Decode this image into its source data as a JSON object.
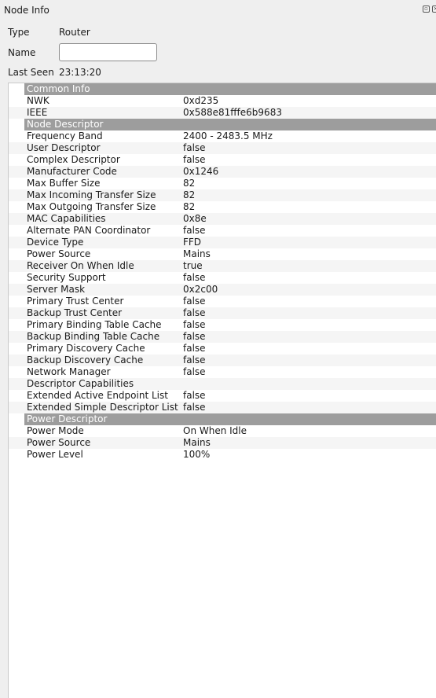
{
  "window": {
    "title": "Node Info"
  },
  "form": {
    "type_label": "Type",
    "type_value": "Router",
    "name_label": "Name",
    "name_value": "",
    "last_seen_label": "Last Seen",
    "last_seen_value": "23:13:20"
  },
  "tree": {
    "rows": [
      {
        "section": true,
        "key": "Common Info",
        "value": ""
      },
      {
        "key": "NWK",
        "value": "0xd235"
      },
      {
        "key": "IEEE",
        "value": "0x588e81fffe6b9683"
      },
      {
        "section": true,
        "key": "Node Descriptor",
        "value": ""
      },
      {
        "key": "Frequency Band",
        "value": "2400 - 2483.5 MHz"
      },
      {
        "key": "User Descriptor",
        "value": "false"
      },
      {
        "key": "Complex Descriptor",
        "value": "false"
      },
      {
        "key": "Manufacturer Code",
        "value": "0x1246"
      },
      {
        "key": "Max Buffer Size",
        "value": "82"
      },
      {
        "key": "Max Incoming Transfer Size",
        "value": "82"
      },
      {
        "key": "Max Outgoing Transfer Size",
        "value": "82"
      },
      {
        "key": "MAC Capabilities",
        "value": "0x8e"
      },
      {
        "key": "Alternate PAN Coordinator",
        "value": "false"
      },
      {
        "key": "Device Type",
        "value": "FFD"
      },
      {
        "key": "Power Source",
        "value": "Mains"
      },
      {
        "key": "Receiver On When Idle",
        "value": "true"
      },
      {
        "key": "Security Support",
        "value": "false"
      },
      {
        "key": "Server Mask",
        "value": "0x2c00"
      },
      {
        "key": "Primary Trust Center",
        "value": "false"
      },
      {
        "key": "Backup Trust Center",
        "value": "false"
      },
      {
        "key": "Primary Binding Table Cache",
        "value": "false"
      },
      {
        "key": "Backup Binding Table Cache",
        "value": "false"
      },
      {
        "key": "Primary Discovery Cache",
        "value": "false"
      },
      {
        "key": "Backup Discovery Cache",
        "value": "false"
      },
      {
        "key": "Network Manager",
        "value": "false"
      },
      {
        "key": "Descriptor Capabilities",
        "value": ""
      },
      {
        "key": "Extended Active Endpoint List",
        "value": "false"
      },
      {
        "key": "Extended Simple Descriptor List",
        "value": "false"
      },
      {
        "section": true,
        "key": "Power Descriptor",
        "value": ""
      },
      {
        "key": "Power Mode",
        "value": "On When Idle"
      },
      {
        "key": "Power Source",
        "value": "Mains"
      },
      {
        "key": "Power Level",
        "value": "100%"
      }
    ]
  }
}
